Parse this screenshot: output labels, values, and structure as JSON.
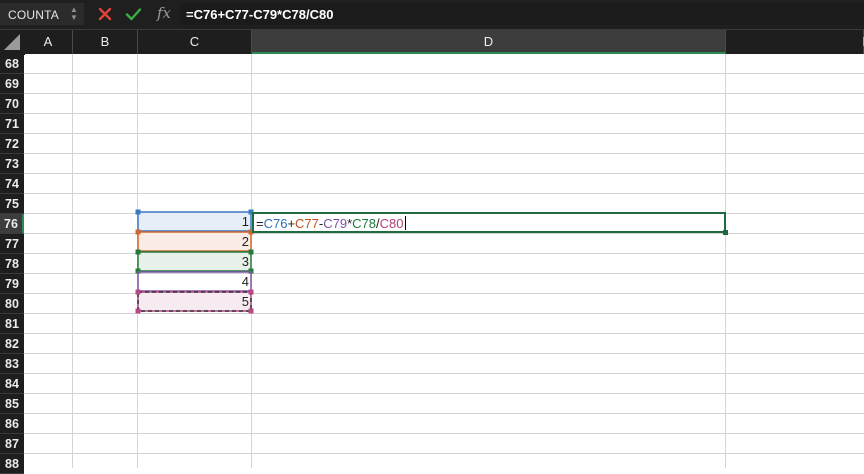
{
  "formula_bar": {
    "name_box": "COUNTA",
    "fx_label": "fx",
    "formula": "=C76+C77-C79*C78/C80"
  },
  "columns": [
    {
      "label": "A"
    },
    {
      "label": "B"
    },
    {
      "label": "C"
    },
    {
      "label": "D"
    },
    {
      "label": "E"
    }
  ],
  "active_column": "D",
  "rows": [
    "68",
    "69",
    "70",
    "71",
    "72",
    "73",
    "74",
    "75",
    "76",
    "77",
    "78",
    "79",
    "80",
    "81",
    "82",
    "83",
    "84",
    "85",
    "86",
    "87",
    "88"
  ],
  "active_row": "76",
  "cells": {
    "C76": "1",
    "C77": "2",
    "C78": "3",
    "C79": "4",
    "C80": "5"
  },
  "edit_cell": {
    "address": "D76",
    "tokens": [
      {
        "text": "=",
        "color": "#222222"
      },
      {
        "text": "C76",
        "color": "#2f6fb7"
      },
      {
        "text": "+",
        "color": "#222222"
      },
      {
        "text": "C77",
        "color": "#c4501f"
      },
      {
        "text": "-",
        "color": "#222222"
      },
      {
        "text": "C79",
        "color": "#7b4fa0"
      },
      {
        "text": "*",
        "color": "#222222"
      },
      {
        "text": "C78",
        "color": "#1e7a3c"
      },
      {
        "text": "/",
        "color": "#222222"
      },
      {
        "text": "C80",
        "color": "#b0417a"
      }
    ]
  },
  "reference_colors": {
    "C76": "#3a78c4",
    "C77": "#d0662a",
    "C78": "#237a3d",
    "C79": "#8255a8",
    "C80": "#b64a86"
  }
}
